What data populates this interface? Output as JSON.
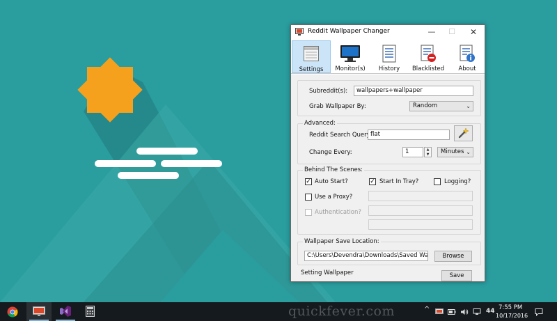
{
  "window": {
    "title": "Reddit Wallpaper Changer",
    "controls": {
      "minimize": "—",
      "maximize": "☐",
      "close": "✕"
    }
  },
  "toolbar": {
    "tabs": [
      {
        "label": "Settings",
        "icon": "settings-icon",
        "active": true
      },
      {
        "label": "Monitor(s)",
        "icon": "monitor-icon",
        "active": false
      },
      {
        "label": "History",
        "icon": "history-icon",
        "active": false
      },
      {
        "label": "Blacklisted",
        "icon": "blacklist-icon",
        "active": false
      },
      {
        "label": "About",
        "icon": "about-icon",
        "active": false
      }
    ]
  },
  "settings": {
    "subreddit": {
      "label": "Subreddit(s):",
      "value": "wallpapers+wallpaper"
    },
    "grab_by": {
      "label": "Grab Wallpaper By:",
      "selected": "Random"
    },
    "advanced": {
      "title": "Advanced:",
      "search_query": {
        "label": "Reddit Search Query:",
        "value": "flat"
      },
      "search_button_icon": "magic-wand-icon",
      "change_every": {
        "label": "Change Every:",
        "value": "1",
        "unit": "Minutes"
      }
    },
    "behind_the_scenes": {
      "title": "Behind The Scenes:",
      "auto_start": {
        "label": "Auto Start?",
        "checked": true
      },
      "start_in_tray": {
        "label": "Start In Tray?",
        "checked": true
      },
      "logging": {
        "label": "Logging?",
        "checked": false
      },
      "use_proxy": {
        "label": "Use a Proxy?",
        "checked": false
      },
      "authentication": {
        "label": "Authentication?",
        "checked": false,
        "enabled": false
      }
    },
    "save_location": {
      "title": "Wallpaper Save Location:",
      "path": "C:\\Users\\Devendra\\Downloads\\Saved Wallpa",
      "browse_label": "Browse"
    },
    "status_text": "Setting Wallpaper",
    "save_label": "Save"
  },
  "taskbar": {
    "pinned": [
      "chrome-icon",
      "monitor-app-icon",
      "visual-studio-icon",
      "calculator-icon"
    ],
    "watermark": "quickfever.com",
    "tray": {
      "chevron": "^",
      "badge": "44",
      "time": "7:55 PM",
      "date": "10/17/2016"
    }
  },
  "colors": {
    "desktop": "#2a9d9f",
    "sun": "#f5a11d",
    "taskbar": "#151a1e",
    "active_tab": "#cce4f7"
  }
}
